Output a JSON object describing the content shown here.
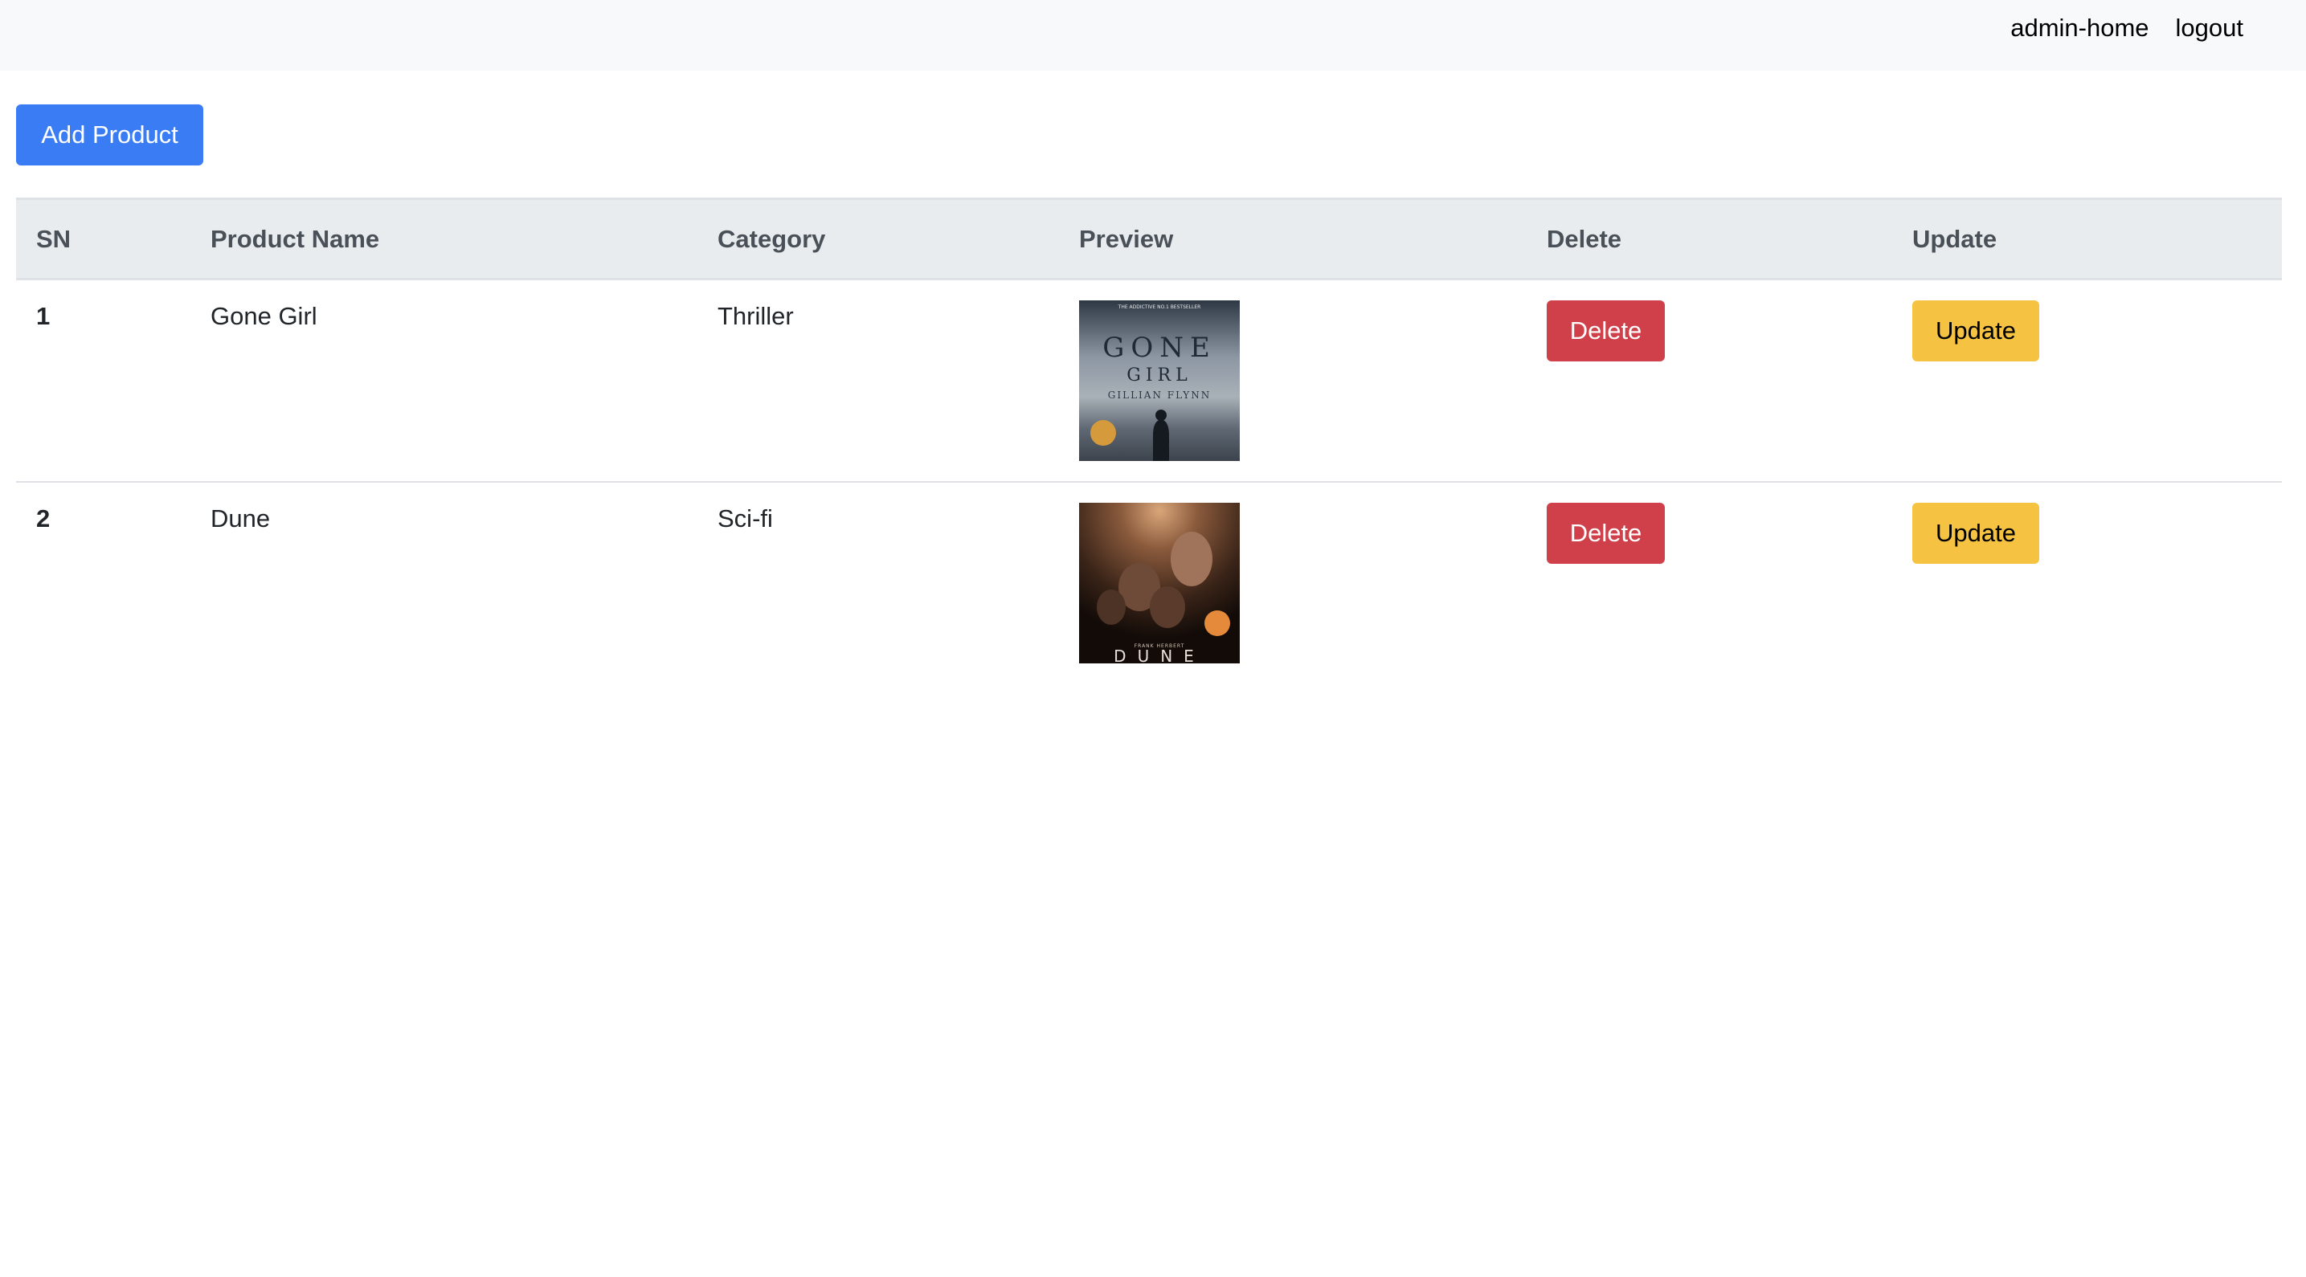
{
  "nav": {
    "links": [
      "admin-home",
      "logout"
    ]
  },
  "toolbar": {
    "add_label": "Add Product"
  },
  "table": {
    "headers": [
      "SN",
      "Product Name",
      "Category",
      "Preview",
      "Delete",
      "Update"
    ],
    "rows": [
      {
        "sn": "1",
        "name": "Gone Girl",
        "category": "Thriller",
        "preview_icon": "book-cover-gone-girl",
        "cover_lines": [
          "THE ADDICTIVE NO.1 BESTSELLER",
          "GONE",
          "GIRL",
          "GILLIAN FLYNN"
        ],
        "delete_label": "Delete",
        "update_label": "Update"
      },
      {
        "sn": "2",
        "name": "Dune",
        "category": "Sci-fi",
        "preview_icon": "book-cover-dune",
        "cover_lines": [
          "FRANK HERBERT",
          "DUNE"
        ],
        "delete_label": "Delete",
        "update_label": "Update"
      }
    ]
  },
  "colors": {
    "primary": "#3a7cf4",
    "danger": "#d0404b",
    "warning": "#f5c242",
    "navbar_bg": "#f8f9fa",
    "table_head_bg": "#e9ecef"
  }
}
